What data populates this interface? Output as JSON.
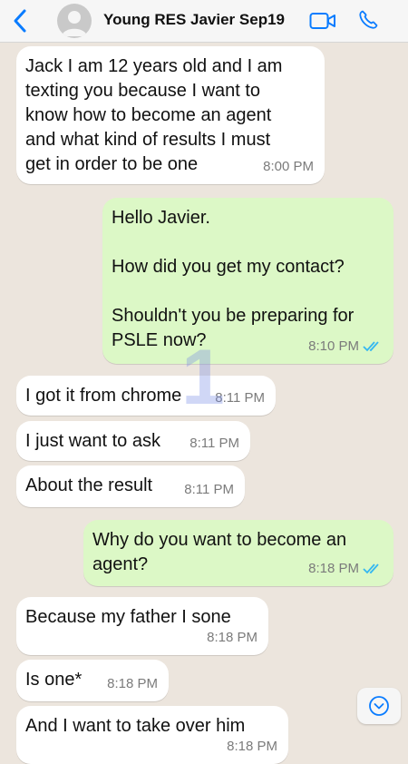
{
  "header": {
    "contact_name": "Young RES Javier Sep19",
    "icons": [
      "chevron-left-icon",
      "avatar",
      "video-camera-icon",
      "phone-icon"
    ],
    "accent_color": "#0a7cff"
  },
  "messages": [
    {
      "direction": "incoming",
      "text": "Jack I am 12 years old and I am\ntexting you because I want to\nknow how to become an agent\nand what kind of results I must\nget in order to be one",
      "time": "8:00 PM"
    },
    {
      "direction": "outgoing",
      "text": "Hello Javier.\n\nHow did you get my contact?\n\nShouldn't you be preparing for\nPSLE now?",
      "time": "8:10 PM",
      "status": "read"
    },
    {
      "direction": "incoming",
      "text": "I got it from chrome",
      "time": "8:11 PM"
    },
    {
      "direction": "incoming",
      "text": "I just want to ask",
      "time": "8:11 PM"
    },
    {
      "direction": "incoming",
      "text": "About the result",
      "time": "8:11 PM"
    },
    {
      "direction": "outgoing",
      "text": "Why do you want to become an\nagent?",
      "time": "8:18 PM",
      "status": "read"
    },
    {
      "direction": "incoming",
      "text": "Because my father I sone",
      "time": "8:18 PM"
    },
    {
      "direction": "incoming",
      "text": "Is one*",
      "time": "8:18 PM"
    },
    {
      "direction": "incoming",
      "text": "And I want to take over him",
      "time": "8:18 PM"
    }
  ],
  "overlay": {
    "watermark_text": "1"
  },
  "colors": {
    "chat_bg": "#ece5dd",
    "incoming_bubble": "#ffffff",
    "outgoing_bubble": "#dcf8c6",
    "read_ticks": "#34b7f1"
  }
}
